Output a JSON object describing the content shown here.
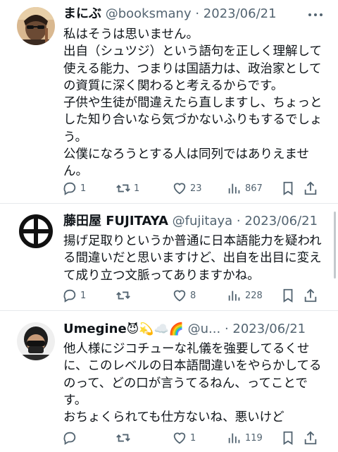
{
  "tweets": [
    {
      "name": "まにぶ",
      "handle": "@booksmany",
      "sep": " · ",
      "date": "2023/06/21",
      "lines": [
        "私はそうは思いません。",
        "出自（シュツジ）という語句を正しく理解して",
        "使える能力、つまりは国語力は、政治家としての資質に深く関わると考えるからです。",
        "子供や生徒が間違えたら直しますし、ちょっとした知り合いなら気づかないふりもするでしょう。",
        "公僕になろうとする人は同列ではありえません。"
      ],
      "replies": "1",
      "retweets": "1",
      "likes": "23",
      "views": "867"
    },
    {
      "name": "藤田屋 FUJITAYA",
      "handle": "@fujitaya",
      "sep": " · ",
      "date": "2023/06/21",
      "lines": [
        "揚げ足取りというか普通に日本語能力を疑われる間違いだと思いますけど、出自を出目に変えて成り立つ文脈ってありますかね。"
      ],
      "replies": "1",
      "retweets": "",
      "likes": "8",
      "views": "228"
    },
    {
      "name": "Umegine",
      "emojis": "😈💫☁️🌈",
      "handle": "@u...",
      "sep": " · ",
      "date": "2023/06/21",
      "lines": [
        "他人様にジコチューな礼儀を強要してるくせに、このレベルの日本語間違いをやらかしてるのって、どの口が言うてるねん、ってことです。",
        "おちょくられても仕方ないね、悪いけど"
      ],
      "replies": "",
      "retweets": "",
      "likes": "1",
      "views": "119"
    }
  ],
  "icons": {
    "reply": "reply-icon",
    "retweet": "retweet-icon",
    "like": "heart-icon",
    "views": "views-icon",
    "bookmark": "bookmark-icon",
    "share": "share-icon",
    "more": "more-icon"
  },
  "colors": {
    "text": "#0f1419",
    "secondary": "#536471",
    "divider": "#e6e9ec"
  }
}
